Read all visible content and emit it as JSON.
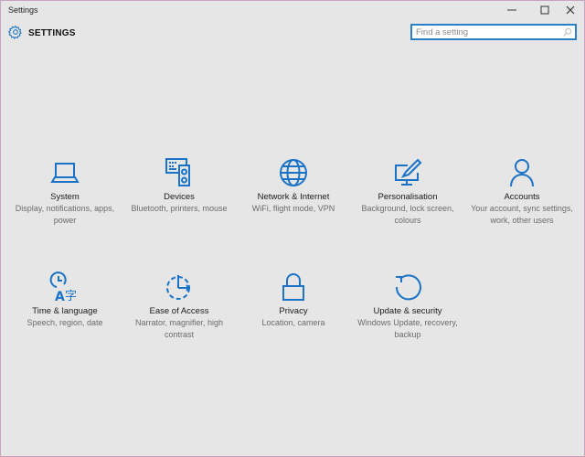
{
  "window": {
    "title": "Settings",
    "controls": {
      "minimize": "—",
      "maximize": "□",
      "close": "✕"
    }
  },
  "header": {
    "app_title": "SETTINGS",
    "icon": "gear-icon"
  },
  "search": {
    "placeholder": "Find a setting",
    "value": "",
    "icon": "search-icon"
  },
  "accent_color": "#1a73c7",
  "tiles": [
    {
      "label": "System",
      "description": "Display, notifications, apps, power",
      "icon": "laptop-icon"
    },
    {
      "label": "Devices",
      "description": "Bluetooth, printers, mouse",
      "icon": "devices-icon"
    },
    {
      "label": "Network & Internet",
      "description": "WiFi, flight mode, VPN",
      "icon": "globe-icon"
    },
    {
      "label": "Personalisation",
      "description": "Background, lock screen, colours",
      "icon": "paintbrush-monitor-icon"
    },
    {
      "label": "Accounts",
      "description": "Your account, sync settings, work, other users",
      "icon": "person-icon"
    },
    {
      "label": "Time & language",
      "description": "Speech, region, date",
      "icon": "time-language-icon"
    },
    {
      "label": "Ease of Access",
      "description": "Narrator, magnifier, high contrast",
      "icon": "ease-of-access-icon"
    },
    {
      "label": "Privacy",
      "description": "Location, camera",
      "icon": "lock-icon"
    },
    {
      "label": "Update & security",
      "description": "Windows Update, recovery, backup",
      "icon": "refresh-icon"
    }
  ]
}
